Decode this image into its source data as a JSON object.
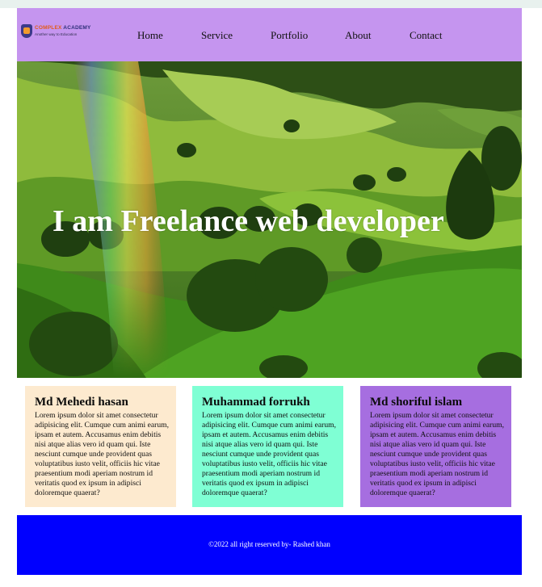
{
  "logo": {
    "title_part1": "COMPLEX",
    "title_part2": " ACADEMY",
    "tagline": "Another way to Education",
    "badge_colors": [
      "#3c3a8a",
      "#f29b2c"
    ]
  },
  "nav": {
    "items": [
      {
        "label": "Home"
      },
      {
        "label": "Service"
      },
      {
        "label": "Portfolio"
      },
      {
        "label": "About"
      },
      {
        "label": "Contact"
      }
    ]
  },
  "hero": {
    "headline": "I am Freelance web developer",
    "image_description_icon": "landscape-hills-rainbow"
  },
  "cards": [
    {
      "name": "Md Mehedi hasan",
      "body": "Lorem ipsum dolor sit amet consectetur adipisicing elit. Cumque cum animi earum, ipsam et autem. Accusamus enim debitis nisi atque alias vero id quam qui. Iste nesciunt cumque unde provident quas voluptatibus iusto velit, officiis hic vitae praesentium modi aperiam nostrum id veritatis quod ex ipsum in adipisci doloremque quaerat?",
      "bg": "#fdeacf"
    },
    {
      "name": "Muhammad forrukh",
      "body": "Lorem ipsum dolor sit amet consectetur adipisicing elit. Cumque cum animi earum, ipsam et autem. Accusamus enim debitis nisi atque alias vero id quam qui. Iste nesciunt cumque unde provident quas voluptatibus iusto velit, officiis hic vitae praesentium modi aperiam nostrum id veritatis quod ex ipsum in adipisci doloremque quaerat?",
      "bg": "#7fffd4"
    },
    {
      "name": "Md shoriful islam",
      "body": "Lorem ipsum dolor sit amet consectetur adipisicing elit. Cumque cum animi earum, ipsam et autem. Accusamus enim debitis nisi atque alias vero id quam qui. Iste nesciunt cumque unde provident quas voluptatibus iusto velit, officiis hic vitae praesentium modi aperiam nostrum id veritatis quod ex ipsum in adipisci doloremque quaerat?",
      "bg": "#a66ee0"
    }
  ],
  "footer": {
    "text": "©2022 all right reserved by- Rashed khan"
  },
  "colors": {
    "header_bg": "#c595ef",
    "footer_bg": "#0000ff"
  }
}
